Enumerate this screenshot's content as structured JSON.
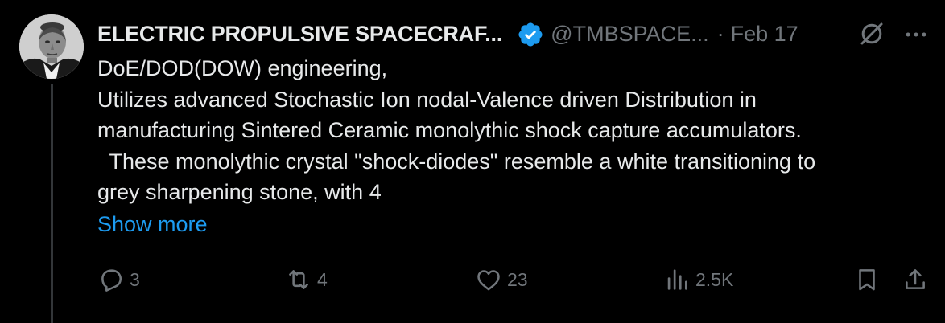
{
  "author": {
    "name": "ELECTRIC PROPULSIVE SPACECRAF...",
    "handle": "@TMBSPACE...",
    "separator": "·",
    "date": "Feb 17",
    "verified_color": "#1d9bf0"
  },
  "post": {
    "lines": [
      "DoE/DOD(DOW) engineering,",
      "Utilizes advanced Stochastic Ion nodal-Valence driven Distribution in",
      "manufacturing Sintered Ceramic monolythic shock capture accumulators.",
      "  These monolythic crystal \"shock-diodes\" resemble a white transitioning to",
      "grey sharpening stone, with 4"
    ],
    "show_more": "Show more"
  },
  "actions": {
    "replies": "3",
    "reposts": "4",
    "likes": "23",
    "views": "2.5K"
  },
  "icons": [
    "avatar",
    "verified-badge-icon",
    "grok-icon",
    "more-icon",
    "reply-icon",
    "repost-icon",
    "like-icon",
    "views-icon",
    "bookmark-icon",
    "share-icon"
  ],
  "colors": {
    "background": "#000000",
    "text": "#e7e9ea",
    "muted": "#71767b",
    "link": "#1d9bf0"
  }
}
